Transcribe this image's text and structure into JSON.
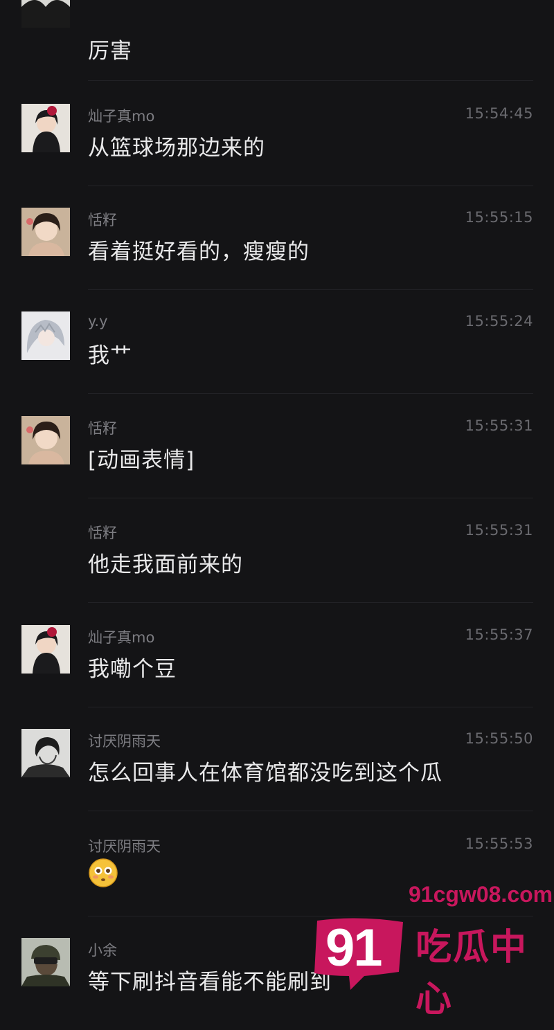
{
  "messages": [
    {
      "sender": "",
      "time": "",
      "text": "厉害",
      "avatar": "person-dark-icon"
    },
    {
      "sender": "灿子真mo",
      "time": "15:54:45",
      "text": "从篮球场那边来的",
      "avatar": "girl-red-flower-icon"
    },
    {
      "sender": "恬籽",
      "time": "15:55:15",
      "text": "看着挺好看的，瘦瘦的",
      "avatar": "girl-portrait-icon"
    },
    {
      "sender": "y.y",
      "time": "15:55:24",
      "text": "我艹",
      "avatar": "anime-white-hair-icon"
    },
    {
      "sender": "恬籽",
      "time": "15:55:31",
      "text": "[动画表情]",
      "avatar": "girl-portrait-icon"
    },
    {
      "sender": "恬籽",
      "time": "15:55:31",
      "text": "他走我面前来的",
      "avatar": ""
    },
    {
      "sender": "灿子真mo",
      "time": "15:55:37",
      "text": "我嘞个豆",
      "avatar": "girl-red-flower-icon"
    },
    {
      "sender": "讨厌阴雨天",
      "time": "15:55:50",
      "text": "怎么回事人在体育馆都没吃到这个瓜",
      "avatar": "man-sketch-icon"
    },
    {
      "sender": "讨厌阴雨天",
      "time": "15:55:53",
      "text": "",
      "emoji": "flushed-face-emoji",
      "avatar": ""
    },
    {
      "sender": "小余",
      "time": "",
      "text": "等下刷抖音看能不能刷到",
      "avatar": "soldier-icon"
    }
  ],
  "watermark": {
    "number": "91",
    "domain": "91cgw08.com",
    "brand": "吃瓜中心",
    "color": "#c8175d"
  }
}
